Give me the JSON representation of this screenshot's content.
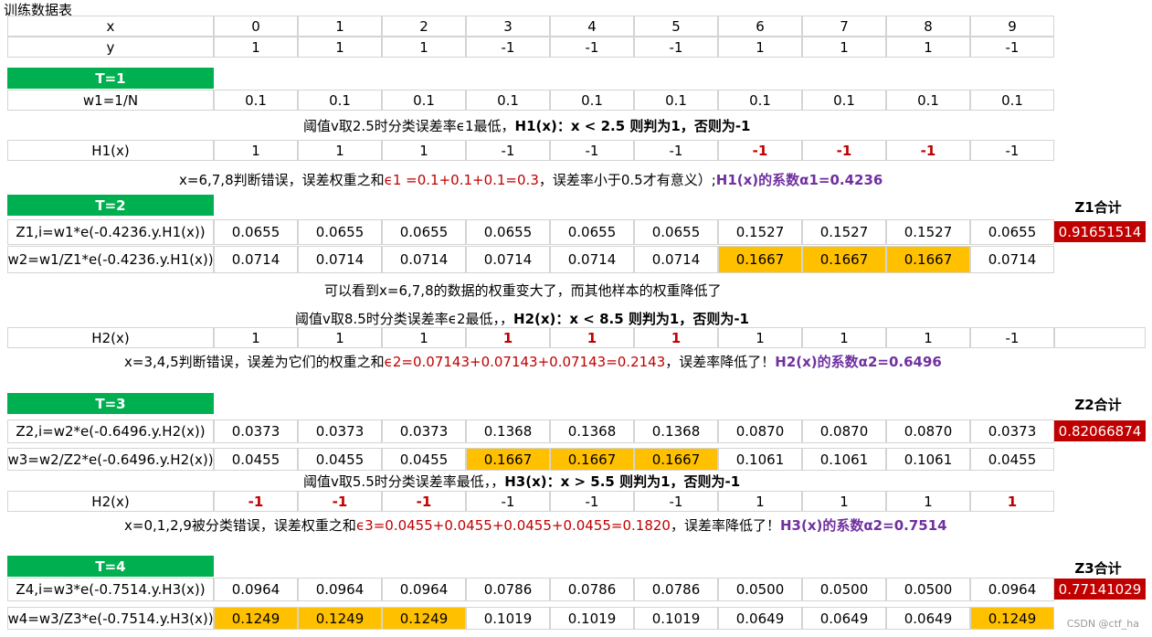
{
  "title": "训练数据表",
  "cols": [
    "0",
    "1",
    "2",
    "3",
    "4",
    "5",
    "6",
    "7",
    "8",
    "9"
  ],
  "rows": {
    "x": {
      "label": "x",
      "v": [
        "0",
        "1",
        "2",
        "3",
        "4",
        "5",
        "6",
        "7",
        "8",
        "9"
      ]
    },
    "y": {
      "label": "y",
      "v": [
        "1",
        "1",
        "1",
        "-1",
        "-1",
        "-1",
        "1",
        "1",
        "1",
        "-1"
      ]
    },
    "w1": {
      "label": "w1=1/N",
      "v": [
        "0.1",
        "0.1",
        "0.1",
        "0.1",
        "0.1",
        "0.1",
        "0.1",
        "0.1",
        "0.1",
        "0.1"
      ]
    },
    "h1": {
      "label": "H1(x)",
      "v": [
        "1",
        "1",
        "1",
        "-1",
        "-1",
        "-1",
        "-1",
        "-1",
        "-1",
        "-1"
      ]
    },
    "z1": {
      "label": "Z1,i=w1*e(-0.4236.y.H1(x))",
      "v": [
        "0.0655",
        "0.0655",
        "0.0655",
        "0.0655",
        "0.0655",
        "0.0655",
        "0.1527",
        "0.1527",
        "0.1527",
        "0.0655"
      ]
    },
    "w2": {
      "label": "w2=w1/Z1*e(-0.4236.y.H1(x))",
      "v": [
        "0.0714",
        "0.0714",
        "0.0714",
        "0.0714",
        "0.0714",
        "0.0714",
        "0.1667",
        "0.1667",
        "0.1667",
        "0.0714"
      ]
    },
    "h2": {
      "label": "H2(x)",
      "v": [
        "1",
        "1",
        "1",
        "1",
        "1",
        "1",
        "1",
        "1",
        "1",
        "-1"
      ]
    },
    "z2": {
      "label": "Z2,i=w2*e(-0.6496.y.H2(x))",
      "v": [
        "0.0373",
        "0.0373",
        "0.0373",
        "0.1368",
        "0.1368",
        "0.1368",
        "0.0870",
        "0.0870",
        "0.0870",
        "0.0373"
      ]
    },
    "w3": {
      "label": "w3=w2/Z2*e(-0.6496.y.H2(x))",
      "v": [
        "0.0455",
        "0.0455",
        "0.0455",
        "0.1667",
        "0.1667",
        "0.1667",
        "0.1061",
        "0.1061",
        "0.1061",
        "0.0455"
      ]
    },
    "h3": {
      "label": "H2(x)",
      "v": [
        "-1",
        "-1",
        "-1",
        "-1",
        "-1",
        "-1",
        "1",
        "1",
        "1",
        "1"
      ]
    },
    "z3": {
      "label": "Z4,i=w3*e(-0.7514.y.H3(x))",
      "v": [
        "0.0964",
        "0.0964",
        "0.0964",
        "0.0786",
        "0.0786",
        "0.0786",
        "0.0500",
        "0.0500",
        "0.0500",
        "0.0964"
      ]
    },
    "w4": {
      "label": "w4=w3/Z3*e(-0.7514.y.H3(x))",
      "v": [
        "0.1249",
        "0.1249",
        "0.1249",
        "0.1019",
        "0.1019",
        "0.1019",
        "0.0649",
        "0.0649",
        "0.0649",
        "0.1249"
      ]
    }
  },
  "banners": {
    "t1": "T=1",
    "t2": "T=2",
    "t3": "T=3",
    "t4": "T=4"
  },
  "notes": {
    "n1a": "阈值v取2.5时分类误差率ϵ1最低，",
    "n1b": "H1(x)：x < 2.5 则判为1，否则为-1",
    "n2a": "x=6,7,8判断错误，误差权重之和",
    "n2b": "ϵ1 =0.1+0.1+0.1=0.3",
    "n2c": "，误差率小于0.5才有意义）;",
    "n2d": "H1(x)的系数α1=0.4236",
    "n3": "可以看到x=6,7,8的数据的权重变大了，而其他样本的权重降低了",
    "n4a": "阈值v取8.5时分类误差率ϵ2最低，，",
    "n4b": "H2(x)：x < 8.5 则判为1，否则为-1",
    "n5a": "x=3,4,5判断错误，误差为它们的权重之和",
    "n5b": "ϵ2=0.07143+0.07143+0.07143=0.2143",
    "n5c": "，误差率降低了！",
    "n5d": "H2(x)的系数α2=0.6496",
    "n6a": "阈值v取5.5时分类误差率最低，，",
    "n6b": "H3(x)：x > 5.5 则判为1，否则为-1",
    "n7a": "x=0,1,2,9被分类错误，误差权重之和",
    "n7b": "ϵ3=0.0455+0.0455+0.0455+0.0455=0.1820",
    "n7c": "，误差率降低了！",
    "n7d": "H3(x)的系数α2=0.7514"
  },
  "z": {
    "z1_label": "Z1合计",
    "z1_value": "0.91651514",
    "z2_label": "Z2合计",
    "z2_value": "0.82066874",
    "z3_label": "Z3合计",
    "z3_value": "0.77141029"
  },
  "watermark": "CSDN @ctf_ha",
  "colors": {
    "banner": "#00b050",
    "highlight": "#ffc000",
    "error": "#c00000",
    "coef": "#7030a0"
  }
}
